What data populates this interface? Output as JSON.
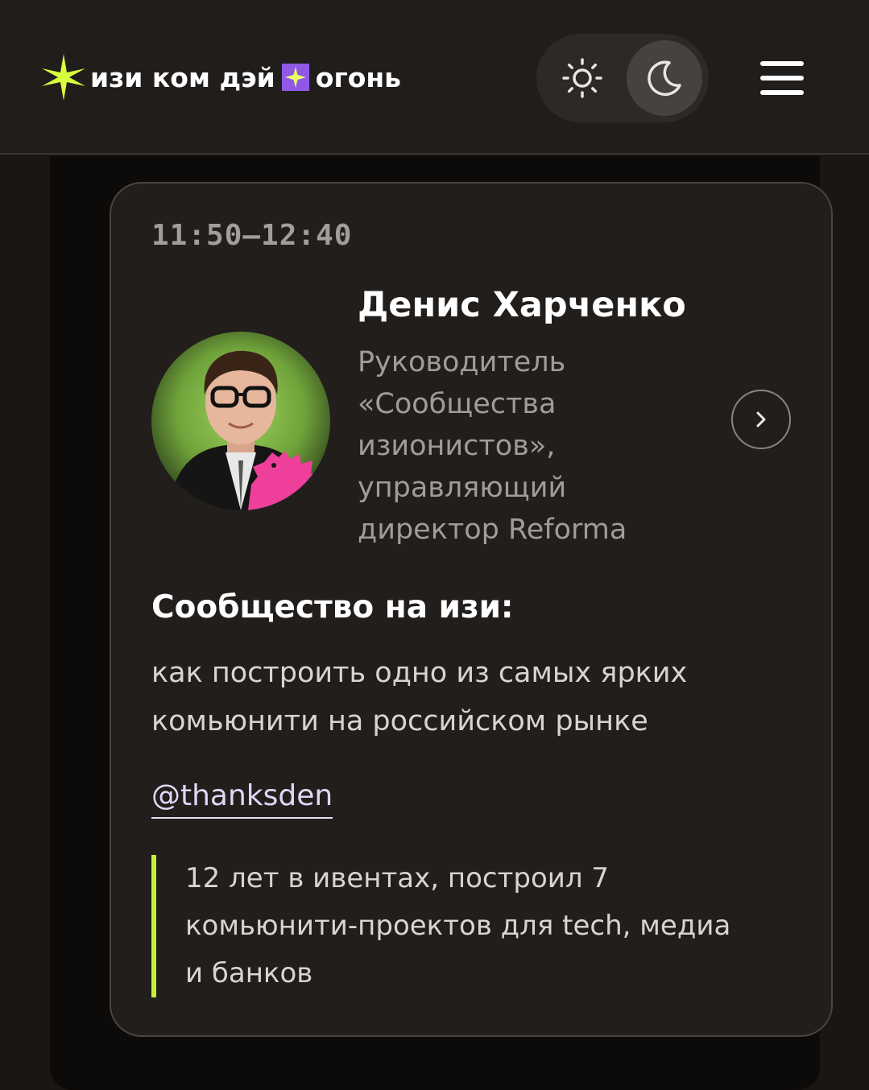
{
  "header": {
    "logo_part1": "изи ком дэй",
    "logo_part2": "огонь",
    "theme_toggle": {
      "options": [
        "light",
        "dark"
      ],
      "selected": "dark"
    },
    "icons": {
      "logo": "sparkle-star-icon",
      "light": "sun-icon",
      "dark": "moon-icon",
      "menu": "hamburger-menu-icon"
    }
  },
  "card": {
    "time": "11:50–12:40",
    "speaker": {
      "name": "Денис Харченко",
      "role": "Руководитель «Сообщества изионистов», управляющий директор Reforma"
    },
    "talk": {
      "title": "Сообщество на изи:",
      "subtitle": "как построить одно из самых ярких комьюнити на российском рынке"
    },
    "handle": "@thanksden",
    "quote": "12 лет в ивентах, построил 7 комьюнити-проектов для tech, медиа и банков",
    "next_icon": "chevron-right-icon"
  },
  "colors": {
    "background": "#1a1614",
    "card": "#221e1c",
    "accent_lime": "#c4f03c",
    "accent_purple": "#8f59e6",
    "accent_pink": "#ee3f9a"
  }
}
